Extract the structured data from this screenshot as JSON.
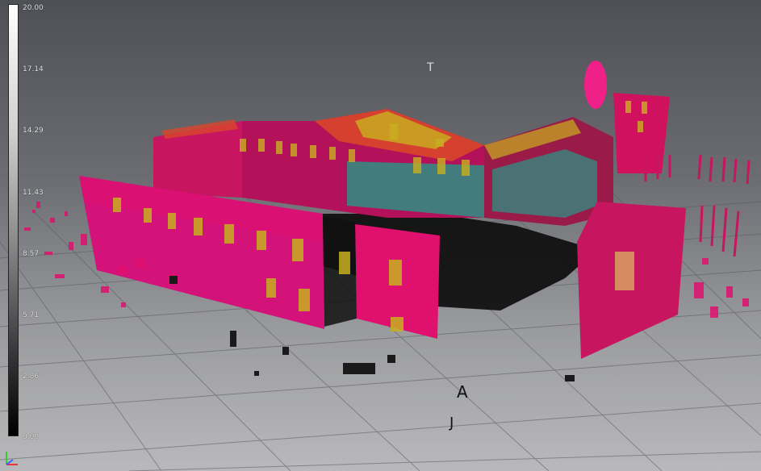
{
  "scale": {
    "labels": [
      "20.00",
      "17.14",
      "14.29",
      "11.43",
      "8.57",
      "5.71",
      "2.86",
      "0.00"
    ],
    "max": 20.0,
    "min": 0.0
  },
  "view": {
    "cursor_glyph": "T",
    "ground_markers": [
      "A",
      "J"
    ]
  },
  "colors": {
    "point_primary": "#e0106e",
    "point_secondary": "#c7155f",
    "point_warm": "#d8462a",
    "point_yellow": "#c8b020",
    "point_teal": "#1ea08a",
    "point_dark": "#111111"
  },
  "icons": {
    "axis_gizmo": "xyz-axis-icon"
  }
}
